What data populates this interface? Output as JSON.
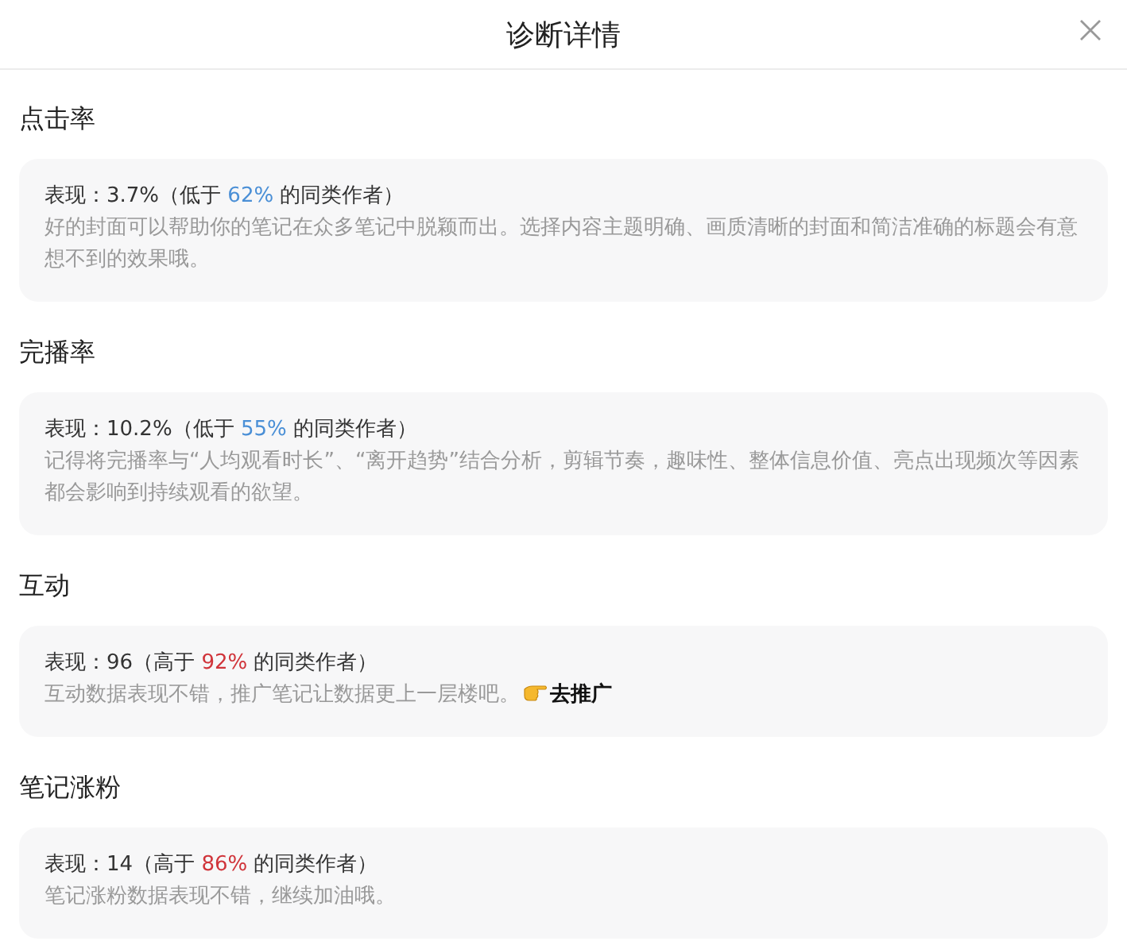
{
  "dialog": {
    "title": "诊断详情"
  },
  "sections": [
    {
      "heading": "点击率",
      "performance_prefix": "表现：3.7%（低于",
      "percent": "62%",
      "color": "#4a8fd6",
      "performance_suffix": "的同类作者）",
      "description": "好的封面可以帮助你的笔记在众多笔记中脱颖而出。选择内容主题明确、画质清晰的封面和简洁准确的标题会有意想不到的效果哦。"
    },
    {
      "heading": "完播率",
      "performance_prefix": "表现：10.2%（低于",
      "percent": "55%",
      "color": "#4a8fd6",
      "performance_suffix": "的同类作者）",
      "description": "记得将完播率与“人均观看时长”、“离开趋势”结合分析，剪辑节奏，趣味性、整体信息价值、亮点出现频次等因素都会影响到持续观看的欲望。"
    },
    {
      "heading": "互动",
      "performance_prefix": "表现：96（高于",
      "percent": "92%",
      "color": "#d0343a",
      "performance_suffix": "的同类作者）",
      "description": "互动数据表现不错，推广笔记让数据更上一层楼吧。",
      "link": "去推广"
    },
    {
      "heading": "笔记涨粉",
      "performance_prefix": "表现：14（高于",
      "percent": "86%",
      "color": "#d0343a",
      "performance_suffix": "的同类作者）",
      "description": "笔记涨粉数据表现不错，继续加油哦。"
    }
  ]
}
